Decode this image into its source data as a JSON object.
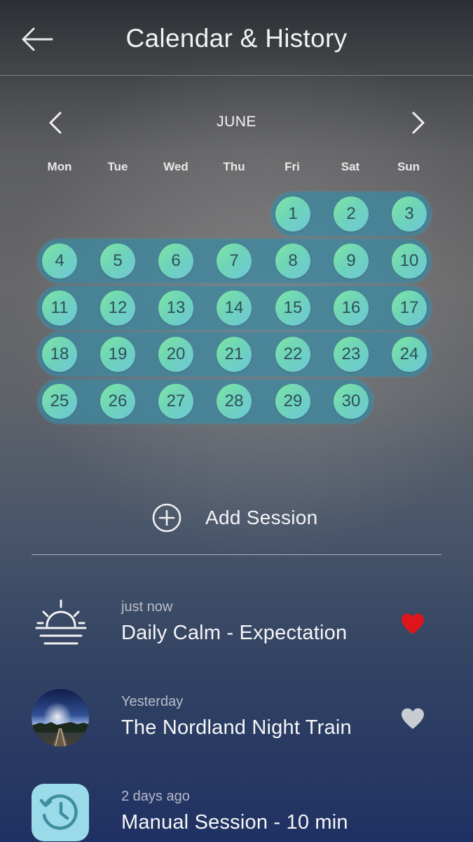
{
  "header": {
    "title": "Calendar & History",
    "back_icon": "arrow-left-icon"
  },
  "calendar": {
    "month": "JUNE",
    "prev_icon": "chevron-left-icon",
    "next_icon": "chevron-right-icon",
    "weekdays": [
      "Mon",
      "Tue",
      "Wed",
      "Thu",
      "Fri",
      "Sat",
      "Sun"
    ],
    "first_weekday_index": 4,
    "days_in_month": 30,
    "completed_days": [
      1,
      2,
      3,
      4,
      5,
      6,
      7,
      8,
      9,
      10,
      11,
      12,
      13,
      14,
      15,
      16,
      17,
      18,
      19,
      20,
      21,
      22,
      23,
      24,
      25,
      26,
      27,
      28,
      29,
      30
    ]
  },
  "add_session": {
    "label": "Add Session",
    "icon": "plus-circle-icon"
  },
  "sessions": [
    {
      "when": "just now",
      "title": "Daily Calm - Expectation",
      "icon": "sunrise-icon",
      "favorite": true
    },
    {
      "when": "Yesterday",
      "title": "The Nordland Night Train",
      "icon": "night-train-thumbnail",
      "favorite": false
    },
    {
      "when": "2 days ago",
      "title": "Manual Session - 10 min",
      "icon": "history-clock-icon",
      "favorite": false
    }
  ],
  "colors": {
    "heart_favorite": "#e0151b",
    "heart_default": "#c9ccd2",
    "day_circle": "#74d8b8",
    "week_band": "#3e88a0",
    "day_number": "#2d4f5b"
  }
}
